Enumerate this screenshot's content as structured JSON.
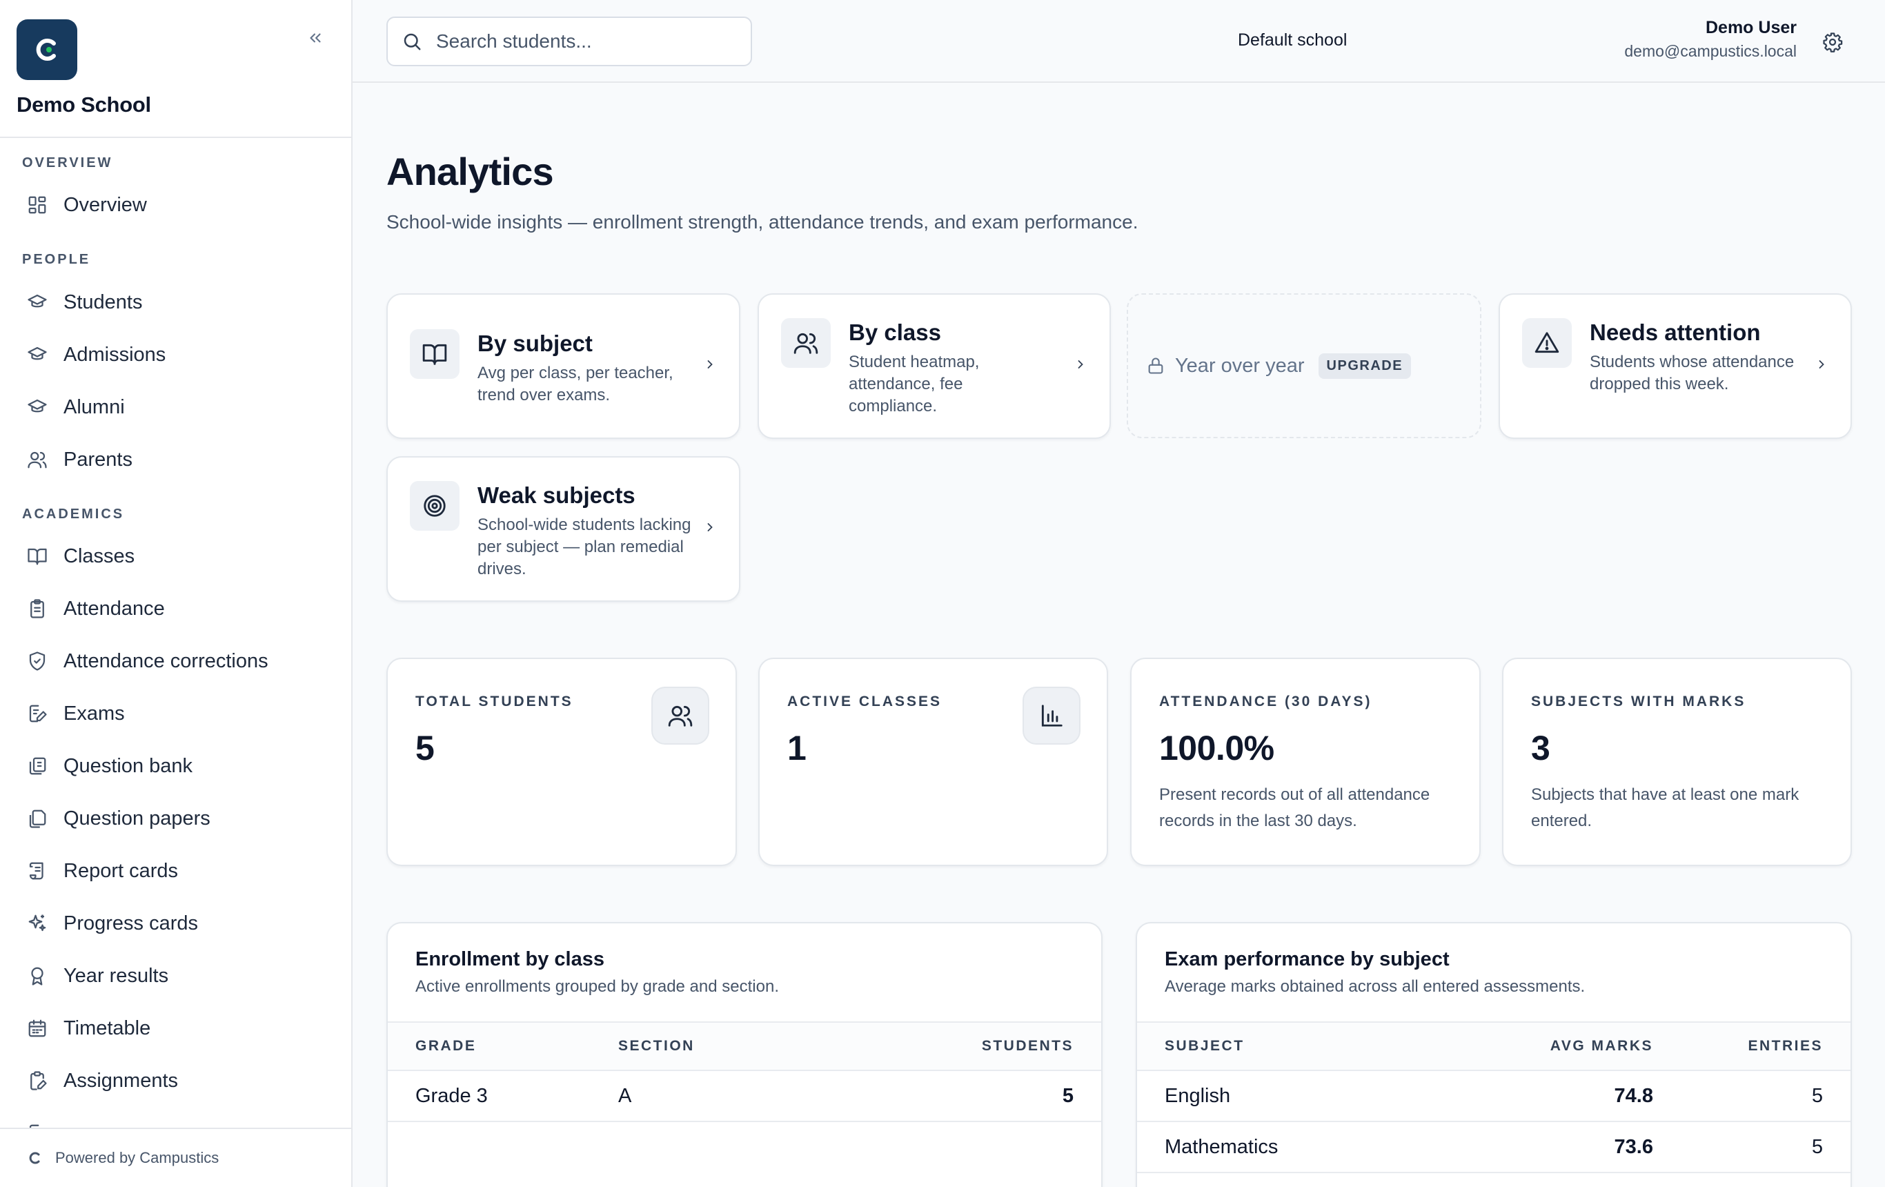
{
  "sidebar": {
    "school_name": "Demo School",
    "sections": {
      "overview": "OVERVIEW",
      "people": "PEOPLE",
      "academics": "ACADEMICS"
    },
    "items": {
      "overview": "Overview",
      "students": "Students",
      "admissions": "Admissions",
      "alumni": "Alumni",
      "parents": "Parents",
      "classes": "Classes",
      "attendance": "Attendance",
      "attendance_corrections": "Attendance corrections",
      "exams": "Exams",
      "question_bank": "Question bank",
      "question_papers": "Question papers",
      "report_cards": "Report cards",
      "progress_cards": "Progress cards",
      "year_results": "Year results",
      "timetable": "Timetable",
      "assignments": "Assignments"
    },
    "footer": "Powered by Campustics"
  },
  "topbar": {
    "search_placeholder": "Search students...",
    "school": "Default school",
    "user_name": "Demo User",
    "user_email": "demo@campustics.local"
  },
  "page": {
    "title": "Analytics",
    "subtitle": "School-wide insights — enrollment strength, attendance trends, and exam performance."
  },
  "link_cards": {
    "by_subject": {
      "title": "By subject",
      "desc": "Avg per class, per teacher, trend over exams."
    },
    "by_class": {
      "title": "By class",
      "desc": "Student heatmap, attendance, fee compliance."
    },
    "year_over_year": {
      "title": "Year over year",
      "badge": "UPGRADE"
    },
    "needs_attention": {
      "title": "Needs attention",
      "desc": "Students whose attendance dropped this week."
    },
    "weak_subjects": {
      "title": "Weak subjects",
      "desc": "School-wide students lacking per subject — plan remedial drives."
    }
  },
  "stats": {
    "total_students": {
      "label": "TOTAL STUDENTS",
      "value": "5"
    },
    "active_classes": {
      "label": "ACTIVE CLASSES",
      "value": "1"
    },
    "attendance": {
      "label": "ATTENDANCE (30 DAYS)",
      "value": "100.0%",
      "note": "Present records out of all attendance records in the last 30 days."
    },
    "subjects_with_marks": {
      "label": "SUBJECTS WITH MARKS",
      "value": "3",
      "note": "Subjects that have at least one mark entered."
    }
  },
  "enrollment": {
    "title": "Enrollment by class",
    "subtitle": "Active enrollments grouped by grade and section.",
    "columns": {
      "grade": "GRADE",
      "section": "SECTION",
      "students": "STUDENTS"
    },
    "rows": [
      {
        "grade": "Grade 3",
        "section": "A",
        "students": "5"
      }
    ]
  },
  "exam_performance": {
    "title": "Exam performance by subject",
    "subtitle": "Average marks obtained across all entered assessments.",
    "columns": {
      "subject": "SUBJECT",
      "avg_marks": "AVG MARKS",
      "entries": "ENTRIES"
    },
    "rows": [
      {
        "subject": "English",
        "avg_marks": "74.8",
        "entries": "5"
      },
      {
        "subject": "Mathematics",
        "avg_marks": "73.6",
        "entries": "5"
      }
    ]
  },
  "colors": {
    "brand": "#173a5e",
    "brand_accent": "#22c55e",
    "text": "#0f172a",
    "muted": "#475569",
    "border": "#e3e7ec"
  }
}
